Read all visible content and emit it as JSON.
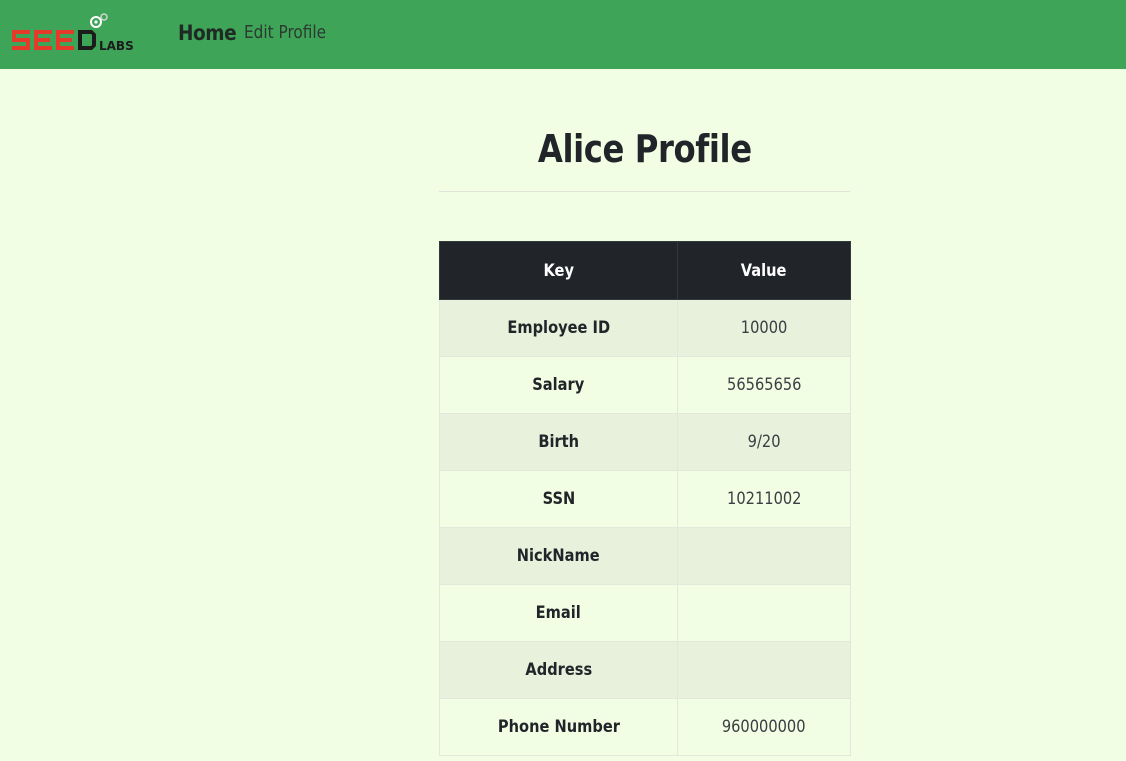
{
  "nav": {
    "logo_text": "SEED LABS",
    "home_label": "Home",
    "edit_profile_label": "Edit Profile",
    "colors": {
      "bar": "#3ea457",
      "logo_red": "#e53a2a",
      "logo_dark": "#1c1c1c"
    }
  },
  "page": {
    "title": "Alice Profile",
    "background": "#f2fee4"
  },
  "table": {
    "headers": [
      "Key",
      "Value"
    ],
    "rows": [
      {
        "key": "Employee ID",
        "value": "10000"
      },
      {
        "key": "Salary",
        "value": "56565656"
      },
      {
        "key": "Birth",
        "value": "9/20"
      },
      {
        "key": "SSN",
        "value": "10211002"
      },
      {
        "key": "NickName",
        "value": ""
      },
      {
        "key": "Email",
        "value": ""
      },
      {
        "key": "Address",
        "value": ""
      },
      {
        "key": "Phone Number",
        "value": "960000000"
      }
    ]
  }
}
